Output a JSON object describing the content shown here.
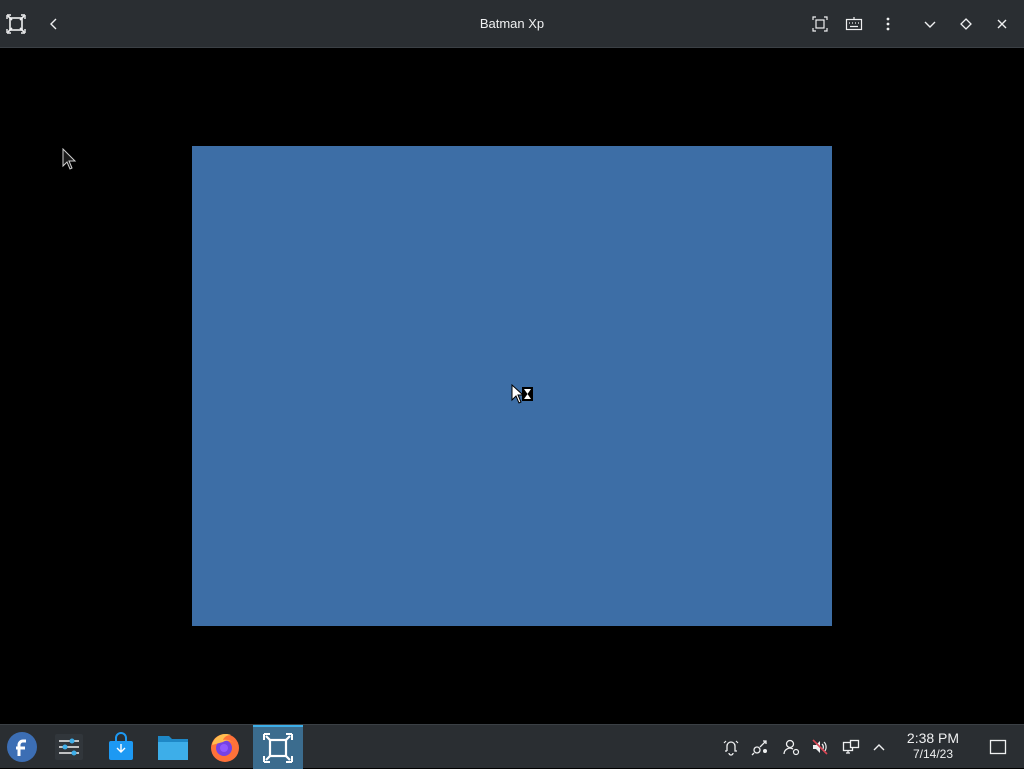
{
  "window": {
    "title": "Batman Xp"
  },
  "titlebar_buttons": {
    "app_icon": "virt-manager-icon",
    "back": "back-arrow-icon",
    "fullscreen": "fullscreen-icon",
    "keyboard": "keyboard-icon",
    "menu": "more-vertical-icon",
    "minimize": "chevron-down-icon",
    "maximize": "diamond-icon",
    "close": "close-icon"
  },
  "vm": {
    "screen_color": "#3d6ea6"
  },
  "taskbar": {
    "launchers": [
      {
        "name": "fedora-launcher",
        "icon": "fedora-logo-icon"
      },
      {
        "name": "system-settings",
        "icon": "settings-sliders-icon"
      },
      {
        "name": "discover-store",
        "icon": "store-bag-icon"
      },
      {
        "name": "file-manager",
        "icon": "folder-icon"
      },
      {
        "name": "firefox",
        "icon": "firefox-icon"
      },
      {
        "name": "boxes",
        "icon": "virt-manager-icon",
        "active": true
      }
    ],
    "tray": [
      "notifications-icon",
      "network-icon",
      "user-icon",
      "volume-muted-icon",
      "display-icon",
      "chevron-up-icon"
    ],
    "clock": {
      "time": "2:38 PM",
      "date": "7/14/23"
    },
    "show_desktop": "show-desktop-icon"
  },
  "colors": {
    "accent": "#3daee9",
    "panel": "#2a2e32",
    "active_task": "#3b6c8e"
  }
}
